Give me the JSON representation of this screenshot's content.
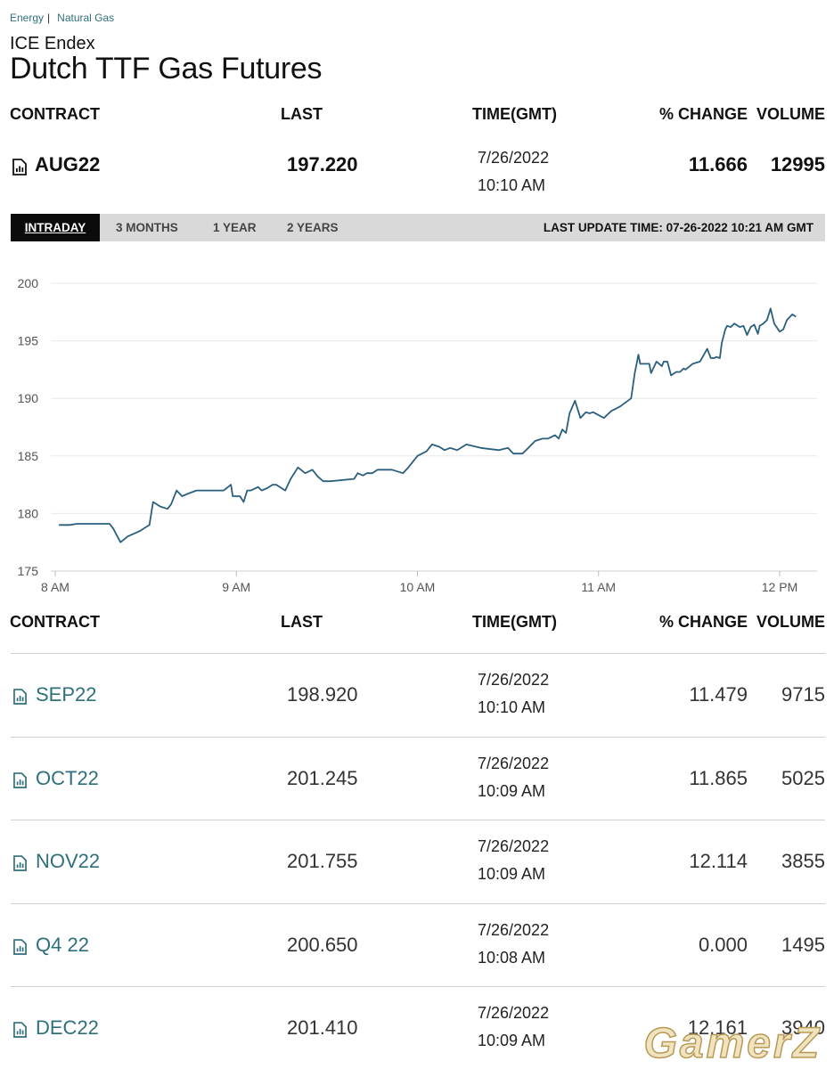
{
  "breadcrumb": {
    "item1": "Energy",
    "separator": "|",
    "item2": "Natural Gas"
  },
  "exchange": "ICE Endex",
  "title": "Dutch TTF Gas Futures",
  "columns": {
    "contract": "CONTRACT",
    "last": "LAST",
    "time": "TIME(GMT)",
    "change": "% CHANGE",
    "volume": "VOLUME"
  },
  "main_contract": {
    "contract": "AUG22",
    "last": "197.220",
    "date": "7/26/2022",
    "time": "10:10 AM",
    "change": "11.666",
    "volume": "12995"
  },
  "tabs": [
    "INTRADAY",
    "3 MONTHS",
    "1 YEAR",
    "2 YEARS"
  ],
  "last_update": "LAST UPDATE TIME: 07-26-2022 10:21 AM GMT",
  "chart_data": {
    "type": "line",
    "title": "",
    "xlabel": "",
    "ylabel": "",
    "xlim": [
      8.0,
      12.25
    ],
    "ylim": [
      175,
      200
    ],
    "x_ticks": [
      8,
      9,
      10,
      11,
      12
    ],
    "x_tick_labels": [
      "8 AM",
      "9 AM",
      "10 AM",
      "11 AM",
      "12 PM"
    ],
    "y_ticks": [
      175,
      180,
      185,
      190,
      195,
      200
    ],
    "y_tick_labels": [
      "175",
      "180",
      "185",
      "190",
      "195",
      "200"
    ],
    "grid": "horizontal",
    "line_color": "#2a5f7e",
    "x": [
      8.02,
      8.08,
      8.12,
      8.2,
      8.3,
      8.32,
      8.34,
      8.36,
      8.4,
      8.47,
      8.52,
      8.54,
      8.58,
      8.62,
      8.64,
      8.67,
      8.7,
      8.73,
      8.78,
      8.84,
      8.93,
      8.97,
      8.98,
      9.02,
      9.04,
      9.06,
      9.08,
      9.12,
      9.14,
      9.17,
      9.2,
      9.22,
      9.27,
      9.3,
      9.34,
      9.38,
      9.42,
      9.45,
      9.48,
      9.52,
      9.65,
      9.67,
      9.7,
      9.72,
      9.75,
      9.78,
      9.86,
      9.92,
      9.95,
      10.0,
      10.05,
      10.08,
      10.12,
      10.15,
      10.18,
      10.22,
      10.27,
      10.35,
      10.45,
      10.5,
      10.53,
      10.58,
      10.6,
      10.65,
      10.69,
      10.72,
      10.76,
      10.78,
      10.8,
      10.82,
      10.84,
      10.87,
      10.9,
      10.93,
      10.95,
      10.97,
      11.03,
      11.07,
      11.12,
      11.18,
      11.2,
      11.22,
      11.23,
      11.25,
      11.28,
      11.29,
      11.32,
      11.35,
      11.36,
      11.38,
      11.4,
      11.43,
      11.45,
      11.47,
      11.48,
      11.52,
      11.56,
      11.6,
      11.62,
      11.64,
      11.65,
      11.67,
      11.68,
      11.7,
      11.71,
      11.73,
      11.75,
      11.78,
      11.8,
      11.82,
      11.84,
      11.86,
      11.88,
      11.89,
      11.91,
      11.93,
      11.95,
      11.97,
      12.0,
      12.02,
      12.04,
      12.07,
      12.09,
      12.12,
      12.15,
      12.18
    ],
    "y": [
      179.0,
      179.0,
      179.1,
      179.1,
      179.1,
      178.7,
      178.1,
      177.5,
      178.0,
      178.5,
      179.0,
      181.0,
      180.6,
      180.4,
      180.8,
      182.0,
      181.5,
      181.7,
      182.0,
      182.0,
      182.0,
      182.5,
      181.5,
      181.5,
      181.0,
      182.0,
      182.0,
      182.3,
      182.0,
      182.2,
      182.5,
      182.5,
      182.0,
      183.0,
      184.0,
      183.5,
      183.8,
      183.2,
      182.8,
      182.8,
      183.0,
      183.5,
      183.3,
      183.5,
      183.5,
      183.8,
      183.8,
      183.5,
      184.0,
      185.0,
      185.4,
      186.0,
      185.8,
      185.5,
      185.7,
      185.5,
      186.0,
      185.7,
      185.5,
      185.7,
      185.2,
      185.2,
      185.5,
      186.3,
      186.5,
      186.5,
      186.8,
      186.5,
      187.3,
      187.0,
      188.7,
      189.8,
      188.3,
      188.8,
      188.7,
      188.8,
      188.3,
      188.9,
      189.3,
      190.0,
      192.2,
      193.8,
      193.0,
      193.0,
      193.0,
      192.2,
      193.2,
      192.8,
      193.2,
      193.2,
      192.0,
      192.3,
      192.3,
      192.6,
      192.5,
      193.0,
      193.2,
      194.3,
      193.5,
      193.5,
      193.6,
      193.5,
      194.8,
      196.0,
      196.3,
      196.2,
      196.5,
      196.2,
      196.3,
      195.5,
      196.2,
      196.4,
      195.6,
      196.3,
      196.5,
      196.8,
      197.8,
      196.5,
      195.8,
      196.0,
      196.8,
      197.3,
      197.1
    ]
  },
  "contracts": [
    {
      "contract": "SEP22",
      "last": "198.920",
      "date": "7/26/2022",
      "time": "10:10 AM",
      "change": "11.479",
      "volume": "9715"
    },
    {
      "contract": "OCT22",
      "last": "201.245",
      "date": "7/26/2022",
      "time": "10:09 AM",
      "change": "11.865",
      "volume": "5025"
    },
    {
      "contract": "NOV22",
      "last": "201.755",
      "date": "7/26/2022",
      "time": "10:09 AM",
      "change": "12.114",
      "volume": "3855"
    },
    {
      "contract": "Q4 22",
      "last": "200.650",
      "date": "7/26/2022",
      "time": "10:08 AM",
      "change": "0.000",
      "volume": "1495"
    },
    {
      "contract": "DEC22",
      "last": "201.410",
      "date": "7/26/2022",
      "time": "10:09 AM",
      "change": "12.161",
      "volume": "3940"
    }
  ],
  "watermark": "GamerZ",
  "colors": {
    "link": "#2e6f7c",
    "line": "#2a5f7e",
    "tab_active": "#0b0b0b",
    "tab_bar": "#d9d9d9"
  }
}
